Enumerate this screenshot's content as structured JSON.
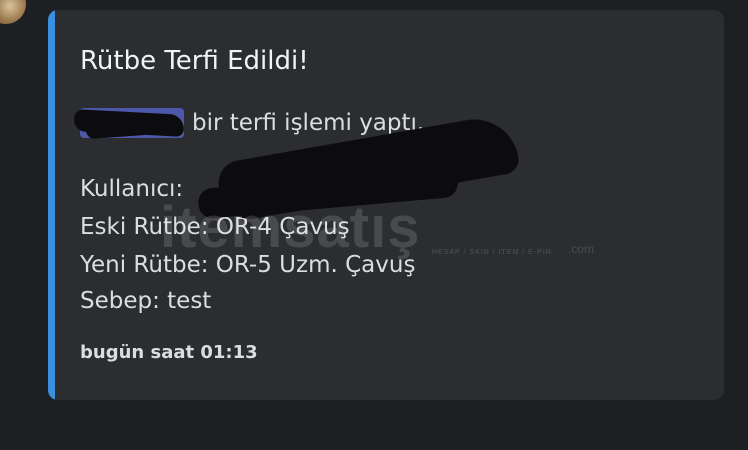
{
  "embed": {
    "accent_color": "#3b8fe0",
    "title": "Rütbe Terfi Edildi!",
    "description_suffix": "bir terfi işlemi yaptı.",
    "fields": {
      "user_label": "Kullanıcı:",
      "old_rank": "Eski Rütbe: OR-4 Çavuş",
      "new_rank": "Yeni Rütbe: OR-5 Uzm. Çavuş",
      "reason": "Sebep: test"
    },
    "timestamp": "bugün saat 01:13"
  },
  "watermark": {
    "brand": "itemsatış",
    "tagline": "HESAP / SKIN / ITEM / E-PIN",
    "domain": ".com"
  }
}
